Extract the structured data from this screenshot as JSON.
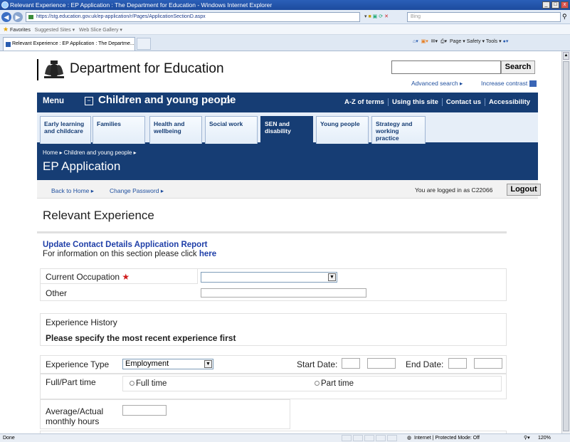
{
  "window": {
    "title": "Relevant Experience : EP Application : The Department for Education - Windows Internet Explorer",
    "address": "https://stg.education.gov.uk/ep-application/r/Pages/ApplicationSectionD.aspx",
    "search_placeholder": "Bing",
    "tab_title": "Relevant Experience : EP Application : The Departme...",
    "favorites_label": "Favorites",
    "suggested_sites": "Suggested Sites ▾",
    "web_slice": "Web Slice Gallery ▾",
    "command_bar": "Page ▾  Safety ▾  Tools ▾",
    "status_left": "Done",
    "status_zone": "Internet | Protected Mode: Off",
    "zoom": "120%"
  },
  "header": {
    "dept_name": "Department for Education",
    "search_button": "Search",
    "advanced_search": "Advanced search ▸",
    "increase_contrast": "Increase contrast"
  },
  "topnav": {
    "menu": "Menu",
    "section": "Children and young people",
    "links": [
      "A-Z of terms",
      "Using this site",
      "Contact us",
      "Accessibility"
    ]
  },
  "tabs": [
    "Early learning\nand childcare",
    "Families",
    "Health and\nwellbeing",
    "Social work",
    "SEN and\ndisability",
    "Young people",
    "Strategy and\nworking\npractice"
  ],
  "band": {
    "breadcrumb": "Home ▸  Children and young people ▸",
    "title": "EP Application"
  },
  "subnav": {
    "back_home": "Back to Home ▸",
    "change_password": "Change Password ▸",
    "logged_in": "You are logged in as C22066",
    "logout": "Logout"
  },
  "page": {
    "title": "Relevant Experience",
    "update_link": "Update Contact Details Application Report",
    "info_text": "For information on this section please click ",
    "info_link": "here"
  },
  "form": {
    "current_occupation_label": "Current Occupation",
    "current_occupation_value": "",
    "other_label": "Other",
    "experience_history": "Experience History",
    "recent_first": "Please specify the most recent experience first",
    "experience_type_label": "Experience Type",
    "experience_type_value": "Employment",
    "start_date_label": "Start Date:",
    "end_date_label": "End Date:",
    "full_part_label": "Full/Part time",
    "full_time": "Full time",
    "part_time": "Part time",
    "hours_label": "Average/Actual\nmonthly hours"
  }
}
